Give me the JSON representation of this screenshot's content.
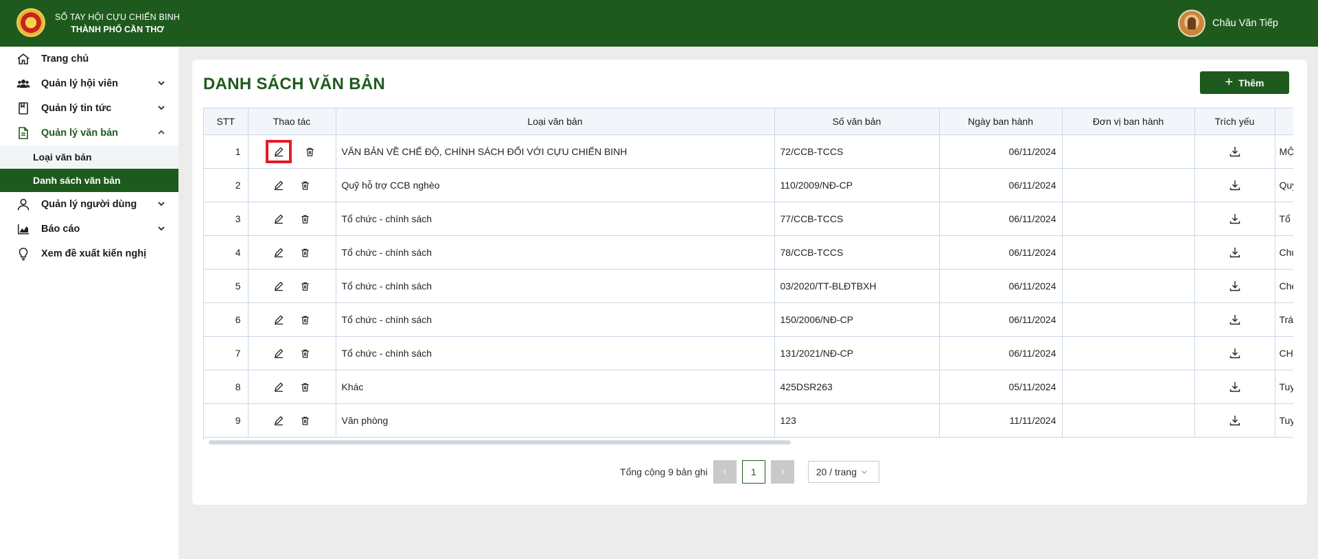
{
  "header": {
    "brand_line1": "SỔ TAY HỘI CỰU CHIẾN BINH",
    "brand_line2": "THÀNH PHỐ CẦN THƠ",
    "user_name": "Châu Văn Tiếp"
  },
  "sidebar": {
    "items": [
      {
        "label": "Trang chủ",
        "icon": "home-icon"
      },
      {
        "label": "Quản lý hội viên",
        "icon": "members-icon"
      },
      {
        "label": "Quản lý tin tức",
        "icon": "news-icon"
      },
      {
        "label": "Quản lý văn bản",
        "icon": "document-icon"
      },
      {
        "label": "Quản lý người dùng",
        "icon": "user-icon"
      },
      {
        "label": "Báo cáo",
        "icon": "chart-icon"
      },
      {
        "label": "Xem đề xuất kiến nghị",
        "icon": "lightbulb-icon"
      }
    ],
    "sub_items": [
      {
        "label": "Loại văn bản"
      },
      {
        "label": "Danh sách văn bản"
      }
    ]
  },
  "main": {
    "title": "DANH SÁCH VĂN BẢN",
    "add_label": "Thêm",
    "columns": [
      "STT",
      "Thao tác",
      "Loại văn bản",
      "Số văn bản",
      "Ngày ban hành",
      "Đơn vị ban hành",
      "Trích yếu"
    ],
    "rows": [
      {
        "stt": "1",
        "loai": "VĂN BẢN VỀ CHẾ ĐỘ, CHÍNH SÁCH ĐỐI VỚI CỰU CHIẾN BINH",
        "so": "72/CCB-TCCS",
        "ngay": "06/11/2024",
        "donvi": "",
        "sum": "MỘ"
      },
      {
        "stt": "2",
        "loai": "Quỹ hỗ trợ CCB nghèo",
        "so": "110/2009/NĐ-CP",
        "ngay": "06/11/2024",
        "donvi": "",
        "sum": "Quy"
      },
      {
        "stt": "3",
        "loai": "Tổ chức - chính sách",
        "so": "77/CCB-TCCS",
        "ngay": "06/11/2024",
        "donvi": "",
        "sum": "Tổ"
      },
      {
        "stt": "4",
        "loai": "Tổ chức - chính sách",
        "so": "78/CCB-TCCS",
        "ngay": "06/11/2024",
        "donvi": "",
        "sum": "Chu"
      },
      {
        "stt": "5",
        "loai": "Tổ chức - chính sách",
        "so": "03/2020/TT-BLĐTBXH",
        "ngay": "06/11/2024",
        "donvi": "",
        "sum": "Che"
      },
      {
        "stt": "6",
        "loai": "Tổ chức - chính sách",
        "so": "150/2006/NĐ-CP",
        "ngay": "06/11/2024",
        "donvi": "",
        "sum": "Trá"
      },
      {
        "stt": "7",
        "loai": "Tổ chức - chính sách",
        "so": "131/2021/NĐ-CP",
        "ngay": "06/11/2024",
        "donvi": "",
        "sum": "CH"
      },
      {
        "stt": "8",
        "loai": "Khác",
        "so": "425DSR263",
        "ngay": "05/11/2024",
        "donvi": "",
        "sum": "Tuy"
      },
      {
        "stt": "9",
        "loai": "Văn phòng",
        "so": "123",
        "ngay": "11/11/2024",
        "donvi": "",
        "sum": "Tuy"
      }
    ]
  },
  "pagination": {
    "total_label": "Tổng cộng 9 bản ghi",
    "current_page": "1",
    "page_size": "20 / trang"
  },
  "colors": {
    "primary": "#1e5a1e",
    "highlight": "#e21c24"
  }
}
